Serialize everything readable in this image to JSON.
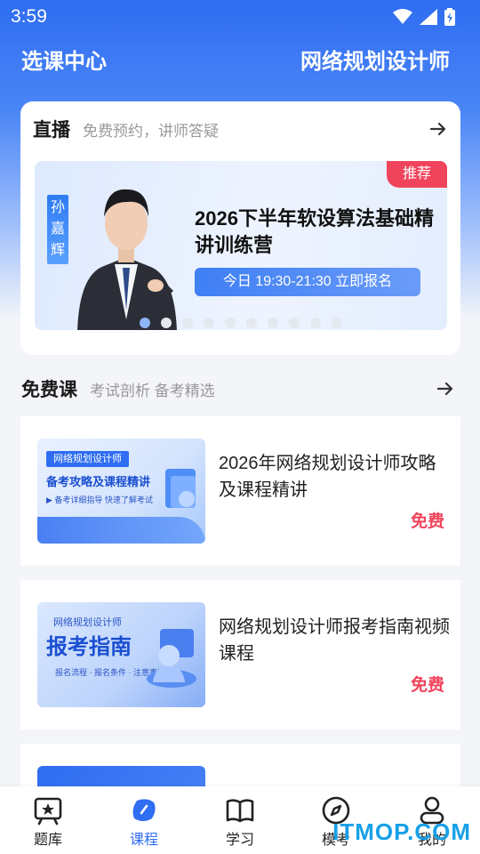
{
  "status_bar": {
    "time": "3:59"
  },
  "header": {
    "left_title": "选课中心",
    "right_title": "网络规划设计师"
  },
  "live": {
    "title": "直播",
    "subtitle": "免费预约，讲师答疑",
    "banner": {
      "teacher_name": "孙嘉辉",
      "badge": "推荐",
      "title": "2026下半年软设算法基础精讲训练营",
      "cta": "今日 19:30-21:30 立即报名"
    },
    "dots_total": 10,
    "dots_active": 0
  },
  "free_courses": {
    "title": "免费课",
    "subtitle": "考试剖析 备考精选",
    "items": [
      {
        "title": "2026年网络规划设计师攻略及课程精讲",
        "price": "免费",
        "thumb_tag": "网络规划设计师",
        "thumb_headline": "备考攻略及课程精讲",
        "thumb_line": "▶ 备考详细指导 快速了解考试"
      },
      {
        "title": "网络规划设计师报考指南视频课程",
        "price": "免费",
        "thumb_tag": "网络规划设计师",
        "thumb_headline": "报考指南",
        "thumb_line": "报名流程 · 报名条件 · 注意事项"
      },
      {
        "title": "",
        "price": "",
        "thumb_tag": "",
        "thumb_headline": "",
        "thumb_line": ""
      }
    ]
  },
  "tabbar": {
    "items": [
      {
        "label": "题库",
        "icon": "question-bank-icon",
        "active": false
      },
      {
        "label": "课程",
        "icon": "course-icon",
        "active": true
      },
      {
        "label": "学习",
        "icon": "book-icon",
        "active": false
      },
      {
        "label": "模考",
        "icon": "compass-icon",
        "active": false
      },
      {
        "label": "我的",
        "icon": "profile-icon",
        "active": false
      }
    ]
  },
  "watermark": "ITMOP.COM",
  "colors": {
    "brand": "#2f6df2",
    "price": "#f0445c"
  }
}
